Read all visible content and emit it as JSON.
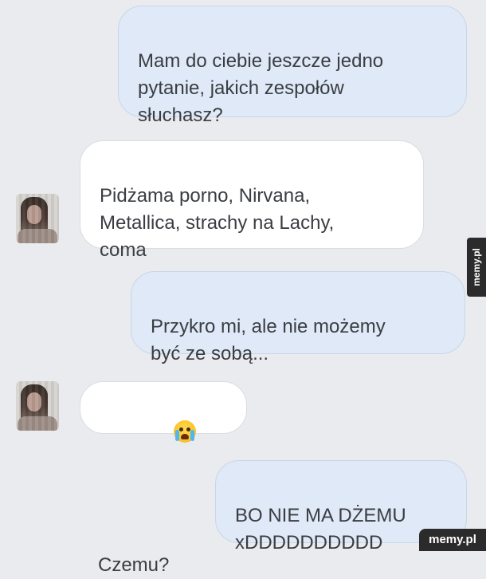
{
  "messages": [
    {
      "id": "m1",
      "from": "me",
      "text": "Mam do ciebie jeszcze jedno\npytanie, jakich zespołów\nsłuchasz?"
    },
    {
      "id": "m2",
      "from": "them",
      "text": "Pidżama porno, Nirvana,\nMetallica, strachy na Lachy,\ncoma"
    },
    {
      "id": "m3",
      "from": "me",
      "text": "Przykro mi, ale nie możemy\nbyć ze sobą..."
    },
    {
      "id": "m4",
      "from": "them",
      "text": "Czemu?",
      "emoji": "crying-face-icon"
    },
    {
      "id": "m5",
      "from": "me",
      "text": "BO NIE MA DŻEMU\nxDDDDDDDDDD"
    }
  ],
  "watermark": {
    "side": "memy.pl",
    "corner": "memy.pl"
  },
  "colors": {
    "background": "#e9ebee",
    "outgoing_bubble": "#dfe9f7",
    "incoming_bubble": "#ffffff",
    "text": "#3a3d42"
  }
}
